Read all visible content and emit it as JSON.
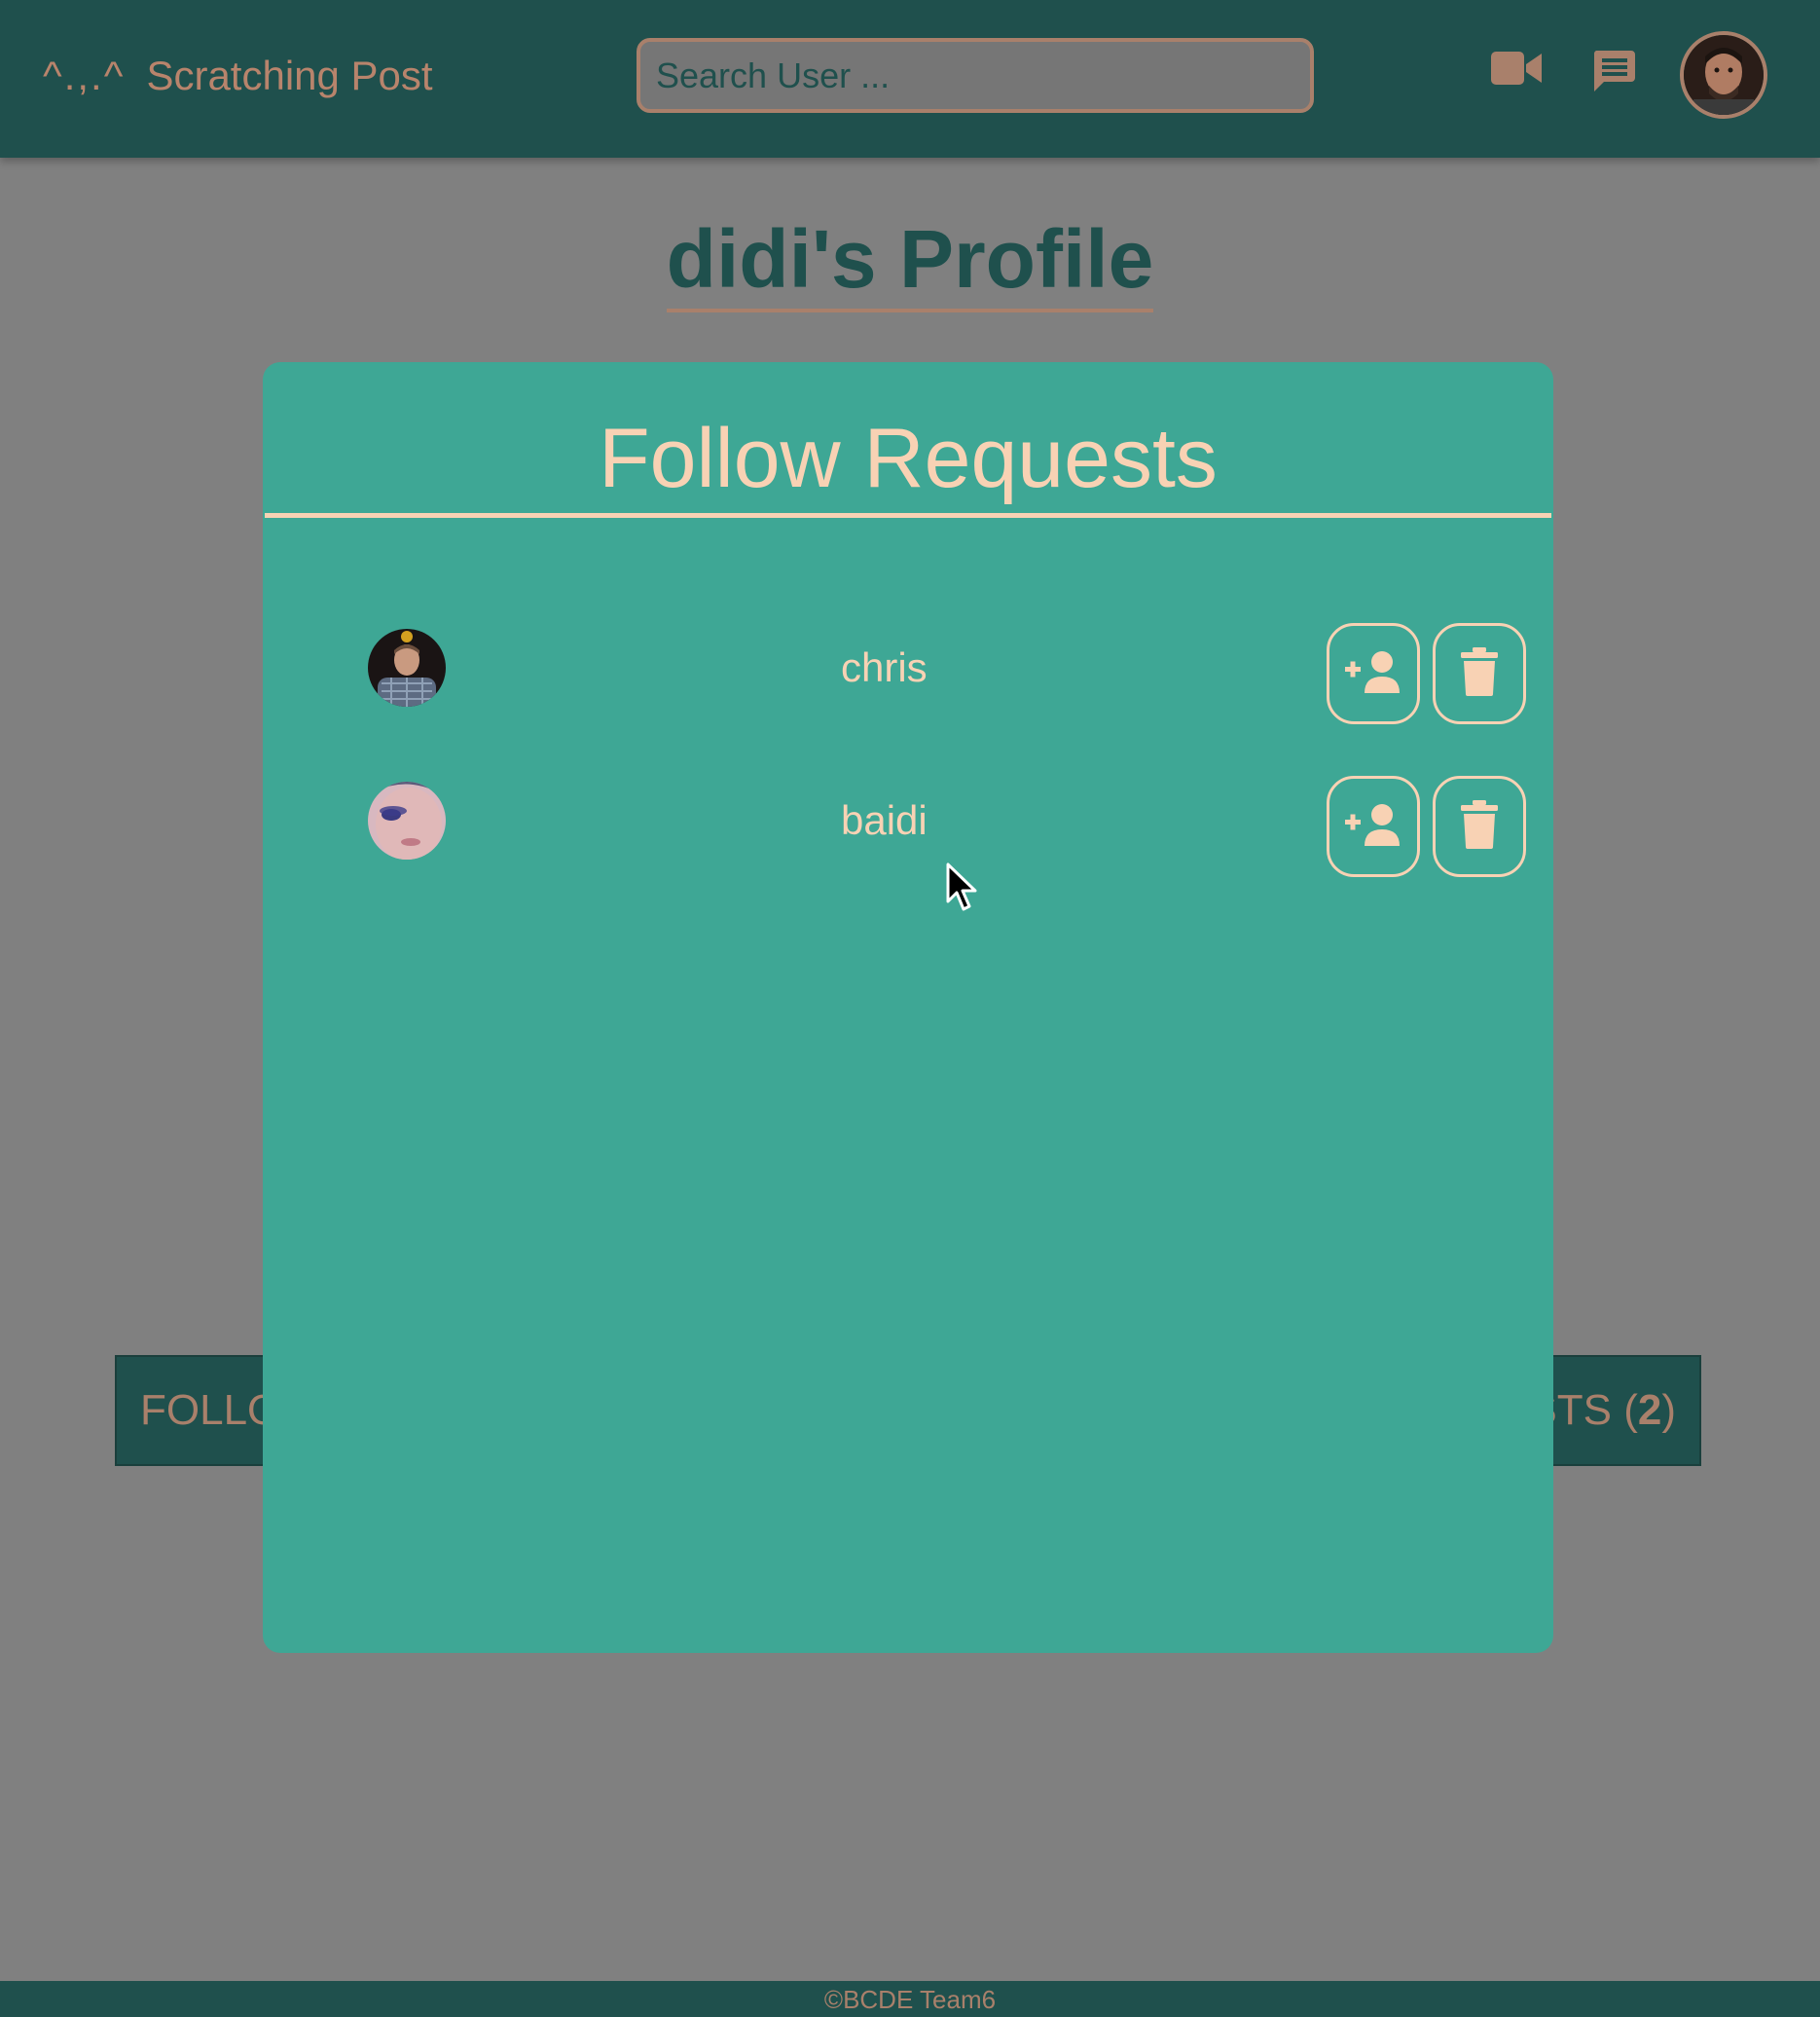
{
  "header": {
    "logo_mark": "^.,.^",
    "app_title": "Scratching Post",
    "search_placeholder": "Search User ...",
    "icons": [
      "video-camera-icon",
      "chat-icon"
    ],
    "user_avatar": "user-avatar"
  },
  "page": {
    "title": "didi's Profile"
  },
  "background_buttons": {
    "left_label_partial": "FOLLO",
    "right_label_partial": "STS (",
    "right_count": "2",
    "right_label_end": ")"
  },
  "modal": {
    "title": "Follow Requests",
    "requests": [
      {
        "name": "chris"
      },
      {
        "name": "baidi"
      }
    ]
  },
  "footer": {
    "text": "©BCDE Team6"
  },
  "colors": {
    "header_bg": "#1f504d",
    "accent_brown": "#a9806b",
    "modal_bg": "#3ea795",
    "modal_text": "#f8d2b4",
    "overlay_gray": "#808080"
  }
}
